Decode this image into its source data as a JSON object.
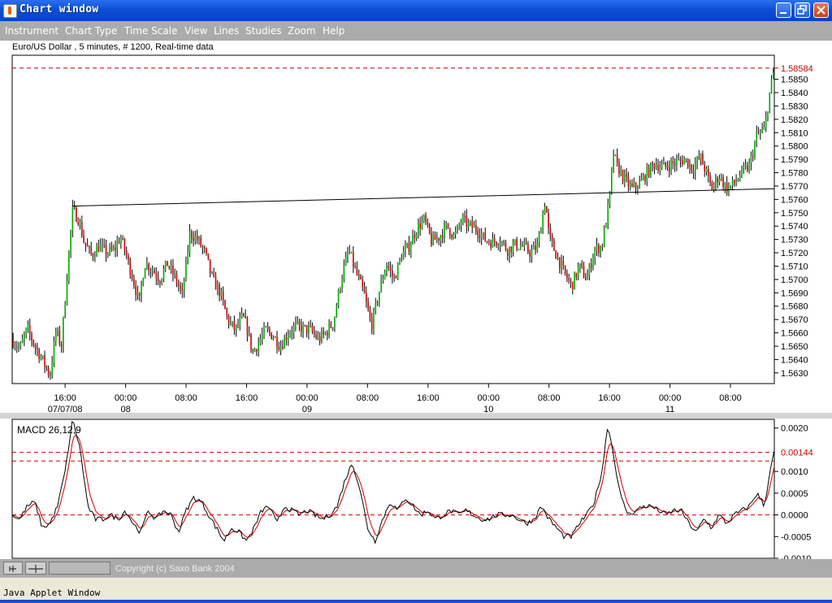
{
  "window": {
    "title": "Chart window",
    "applet_label": "Java Applet Window"
  },
  "menu": [
    "Instrument",
    "Chart Type",
    "Time Scale",
    "View",
    "Lines",
    "Studies",
    "Zoom",
    "Help"
  ],
  "status": {
    "copyright": "Copyright (c) Saxo Bank 2004"
  },
  "colors": {
    "bull": "#00aa00",
    "bear": "#cc0000",
    "wick": "#000000",
    "ref_line": "#cc0000",
    "macd_line": "#000000",
    "signal_line": "#cc0000"
  },
  "chart_data": [
    {
      "type": "candlestick",
      "title": "Euro/US Dollar , 5 minutes, # 1200, Real-time data",
      "ylim": [
        1.5622,
        1.5868
      ],
      "yticks": [
        "1.5630",
        "1.5640",
        "1.5650",
        "1.5660",
        "1.5670",
        "1.5680",
        "1.5690",
        "1.5700",
        "1.5710",
        "1.5720",
        "1.5730",
        "1.5740",
        "1.5750",
        "1.5760",
        "1.5770",
        "1.5780",
        "1.5790",
        "1.5800",
        "1.5810",
        "1.5820",
        "1.5830",
        "1.5840",
        "1.5850"
      ],
      "xticks": [
        {
          "label": "16:00",
          "date": "07/07/08",
          "t": 5.0
        },
        {
          "label": "00:00",
          "date": "08",
          "t": 13.0
        },
        {
          "label": "08:00",
          "date": "",
          "t": 21.0
        },
        {
          "label": "16:00",
          "date": "",
          "t": 29.0
        },
        {
          "label": "00:00",
          "date": "09",
          "t": 37.0
        },
        {
          "label": "08:00",
          "date": "",
          "t": 45.0
        },
        {
          "label": "16:00",
          "date": "",
          "t": 53.0
        },
        {
          "label": "00:00",
          "date": "10",
          "t": 61.0
        },
        {
          "label": "08:00",
          "date": "",
          "t": 69.0
        },
        {
          "label": "16:00",
          "date": "",
          "t": 77.0
        },
        {
          "label": "00:00",
          "date": "11",
          "t": 85.0
        },
        {
          "label": "08:00",
          "date": "",
          "t": 93.0
        }
      ],
      "t_range": [
        -2.0,
        98.8
      ],
      "current_price": {
        "value": 1.58584,
        "label": "1.58584"
      },
      "trendline": {
        "t0": 6.0,
        "p0": 1.5755,
        "t1": 98.8,
        "p1": 1.5768
      },
      "path": [
        [
          -2.0,
          1.5655
        ],
        [
          -1.0,
          1.5648
        ],
        [
          0.0,
          1.5663
        ],
        [
          1.0,
          1.565
        ],
        [
          2.0,
          1.564
        ],
        [
          3.0,
          1.5628
        ],
        [
          3.8,
          1.5662
        ],
        [
          4.5,
          1.565
        ],
        [
          5.5,
          1.572
        ],
        [
          6.0,
          1.5752
        ],
        [
          6.8,
          1.5745
        ],
        [
          7.5,
          1.5728
        ],
        [
          8.5,
          1.5718
        ],
        [
          9.5,
          1.5725
        ],
        [
          10.5,
          1.572
        ],
        [
          11.5,
          1.5722
        ],
        [
          12.3,
          1.5732
        ],
        [
          13.0,
          1.572
        ],
        [
          14.0,
          1.57
        ],
        [
          14.8,
          1.5682
        ],
        [
          15.5,
          1.5712
        ],
        [
          16.5,
          1.5708
        ],
        [
          17.5,
          1.57
        ],
        [
          18.5,
          1.5712
        ],
        [
          19.5,
          1.5702
        ],
        [
          20.5,
          1.5688
        ],
        [
          21.5,
          1.5735
        ],
        [
          22.5,
          1.573
        ],
        [
          23.5,
          1.572
        ],
        [
          24.5,
          1.57
        ],
        [
          25.5,
          1.569
        ],
        [
          26.5,
          1.567
        ],
        [
          27.5,
          1.5662
        ],
        [
          28.5,
          1.5672
        ],
        [
          29.0,
          1.5665
        ],
        [
          29.8,
          1.5645
        ],
        [
          30.5,
          1.5652
        ],
        [
          31.5,
          1.5662
        ],
        [
          32.5,
          1.5658
        ],
        [
          33.5,
          1.565
        ],
        [
          34.5,
          1.566
        ],
        [
          35.5,
          1.5665
        ],
        [
          36.5,
          1.5663
        ],
        [
          37.5,
          1.5662
        ],
        [
          38.5,
          1.5655
        ],
        [
          39.5,
          1.566
        ],
        [
          40.5,
          1.5668
        ],
        [
          41.5,
          1.57
        ],
        [
          42.5,
          1.5722
        ],
        [
          43.5,
          1.5705
        ],
        [
          44.5,
          1.569
        ],
        [
          45.5,
          1.5665
        ],
        [
          46.5,
          1.569
        ],
        [
          47.5,
          1.5712
        ],
        [
          48.5,
          1.57
        ],
        [
          49.5,
          1.5718
        ],
        [
          50.5,
          1.5725
        ],
        [
          51.5,
          1.5738
        ],
        [
          52.5,
          1.5745
        ],
        [
          53.5,
          1.5728
        ],
        [
          54.5,
          1.5732
        ],
        [
          55.5,
          1.574
        ],
        [
          56.5,
          1.5732
        ],
        [
          57.5,
          1.5745
        ],
        [
          58.5,
          1.574
        ],
        [
          59.5,
          1.5738
        ],
        [
          60.5,
          1.573
        ],
        [
          61.5,
          1.5728
        ],
        [
          62.5,
          1.573
        ],
        [
          63.5,
          1.5722
        ],
        [
          64.5,
          1.5726
        ],
        [
          65.5,
          1.5725
        ],
        [
          66.5,
          1.572
        ],
        [
          67.5,
          1.5725
        ],
        [
          68.5,
          1.576
        ],
        [
          69.0,
          1.5732
        ],
        [
          70.0,
          1.5718
        ],
        [
          71.0,
          1.5705
        ],
        [
          72.0,
          1.5695
        ],
        [
          73.0,
          1.571
        ],
        [
          74.0,
          1.57
        ],
        [
          75.0,
          1.5722
        ],
        [
          76.0,
          1.5725
        ],
        [
          77.0,
          1.576
        ],
        [
          77.5,
          1.5795
        ],
        [
          78.0,
          1.5785
        ],
        [
          79.0,
          1.5775
        ],
        [
          80.0,
          1.5768
        ],
        [
          81.0,
          1.5772
        ],
        [
          82.0,
          1.578
        ],
        [
          83.0,
          1.5787
        ],
        [
          84.0,
          1.5784
        ],
        [
          85.0,
          1.5786
        ],
        [
          86.0,
          1.5788
        ],
        [
          87.0,
          1.579
        ],
        [
          88.0,
          1.5783
        ],
        [
          89.0,
          1.5792
        ],
        [
          89.8,
          1.578
        ],
        [
          90.5,
          1.5768
        ],
        [
          91.5,
          1.5778
        ],
        [
          92.5,
          1.5768
        ],
        [
          93.5,
          1.5772
        ],
        [
          94.5,
          1.578
        ],
        [
          95.5,
          1.5785
        ],
        [
          96.5,
          1.5808
        ],
        [
          97.5,
          1.5812
        ],
        [
          98.2,
          1.584
        ],
        [
          98.8,
          1.5858
        ]
      ]
    },
    {
      "type": "line",
      "title": "MACD 26,12,9",
      "ylim": [
        -0.001,
        0.0022
      ],
      "yticks": [
        "-0.0010",
        "-0.0005",
        "0.0000",
        "0.0005",
        "0.0010",
        "0.0020"
      ],
      "ref_lines": [
        0.0,
        0.00124
      ],
      "current": {
        "value": 0.00144,
        "label": "0.00144"
      },
      "macd_path": [
        [
          -2.0,
          0.0
        ],
        [
          -1.0,
          -0.0001
        ],
        [
          0.0,
          0.0002
        ],
        [
          1.0,
          0.0003
        ],
        [
          2.0,
          -0.0003
        ],
        [
          3.0,
          -0.0002
        ],
        [
          4.0,
          0.0002
        ],
        [
          5.0,
          0.001
        ],
        [
          6.0,
          0.0022
        ],
        [
          7.0,
          0.0015
        ],
        [
          8.0,
          0.0002
        ],
        [
          9.0,
          -0.0001
        ],
        [
          10.0,
          -0.0001
        ],
        [
          11.0,
          0.0
        ],
        [
          12.0,
          -0.0001
        ],
        [
          13.0,
          0.0001
        ],
        [
          14.0,
          -0.0002
        ],
        [
          15.0,
          -0.0004
        ],
        [
          16.0,
          0.0001
        ],
        [
          17.0,
          -0.0001
        ],
        [
          18.0,
          0.0001
        ],
        [
          19.0,
          0.0
        ],
        [
          20.0,
          -0.0004
        ],
        [
          21.0,
          0.0001
        ],
        [
          22.0,
          0.0004
        ],
        [
          23.0,
          0.0003
        ],
        [
          24.0,
          0.0
        ],
        [
          25.0,
          -0.0003
        ],
        [
          26.0,
          -0.0006
        ],
        [
          27.0,
          -0.0003
        ],
        [
          28.0,
          -0.0004
        ],
        [
          29.0,
          -0.0006
        ],
        [
          30.0,
          -0.0003
        ],
        [
          31.0,
          0.0001
        ],
        [
          32.0,
          0.0002
        ],
        [
          33.0,
          -0.0002
        ],
        [
          34.0,
          0.0002
        ],
        [
          35.0,
          0.0001
        ],
        [
          36.0,
          0.0
        ],
        [
          37.0,
          0.0001
        ],
        [
          38.0,
          0.0
        ],
        [
          39.0,
          -0.0001
        ],
        [
          40.0,
          0.0
        ],
        [
          41.0,
          0.0002
        ],
        [
          42.0,
          0.0008
        ],
        [
          43.0,
          0.0012
        ],
        [
          44.0,
          0.0006
        ],
        [
          45.0,
          -0.0003
        ],
        [
          46.0,
          -0.0006
        ],
        [
          47.0,
          -0.0001
        ],
        [
          48.0,
          0.0003
        ],
        [
          49.0,
          0.0001
        ],
        [
          50.0,
          0.0004
        ],
        [
          51.0,
          0.0002
        ],
        [
          52.0,
          0.0
        ],
        [
          53.0,
          0.0001
        ],
        [
          54.0,
          -0.0001
        ],
        [
          55.0,
          0.0
        ],
        [
          56.0,
          0.0001
        ],
        [
          57.0,
          0.0
        ],
        [
          58.0,
          0.0001
        ],
        [
          59.0,
          0.0
        ],
        [
          60.0,
          -0.0001
        ],
        [
          61.0,
          -0.0001
        ],
        [
          62.0,
          0.0
        ],
        [
          63.0,
          0.0
        ],
        [
          64.0,
          0.0
        ],
        [
          65.0,
          -0.0001
        ],
        [
          66.0,
          -0.0002
        ],
        [
          67.0,
          -0.0001
        ],
        [
          68.0,
          0.0002
        ],
        [
          69.0,
          -0.0001
        ],
        [
          70.0,
          -0.0003
        ],
        [
          71.0,
          -0.0005
        ],
        [
          72.0,
          -0.0005
        ],
        [
          73.0,
          -0.0002
        ],
        [
          74.0,
          0.0
        ],
        [
          75.0,
          0.0003
        ],
        [
          76.0,
          0.001
        ],
        [
          76.8,
          0.0021
        ],
        [
          77.5,
          0.0014
        ],
        [
          78.5,
          0.0004
        ],
        [
          79.5,
          0.0
        ],
        [
          80.5,
          0.0001
        ],
        [
          81.5,
          0.0002
        ],
        [
          82.5,
          0.0002
        ],
        [
          83.5,
          0.0001
        ],
        [
          84.5,
          0.0
        ],
        [
          85.5,
          0.0001
        ],
        [
          86.5,
          0.0001
        ],
        [
          87.5,
          -0.0002
        ],
        [
          88.5,
          -0.0004
        ],
        [
          89.5,
          -0.0001
        ],
        [
          90.5,
          -0.0003
        ],
        [
          91.5,
          0.0
        ],
        [
          92.5,
          -0.0002
        ],
        [
          93.5,
          0.0
        ],
        [
          94.5,
          0.0001
        ],
        [
          95.5,
          0.0002
        ],
        [
          96.5,
          0.0005
        ],
        [
          97.5,
          0.0002
        ],
        [
          98.2,
          0.001
        ],
        [
          98.8,
          0.00144
        ]
      ]
    }
  ]
}
